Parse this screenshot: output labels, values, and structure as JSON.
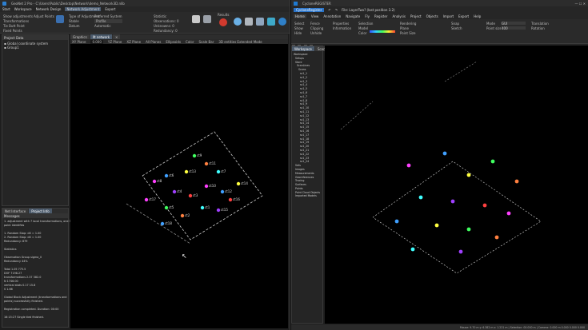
{
  "left_app": {
    "title": "GeoNet 2 Pro - C:\\Users\\Public\\Desktop\\Network\\demo_Network3D.nlib",
    "menu": [
      "Start",
      "Workspace",
      "Network Design",
      "Network Adjustment",
      "Export"
    ],
    "ribbon": {
      "g1": [
        "Show adjustments",
        "Transformations",
        "Tie Butt Point",
        "Fixed Points"
      ],
      "g2": [
        "Adjust Points"
      ],
      "g3": [
        "Type of Adjustment",
        "Stable",
        "Datum"
      ],
      "g4": [
        "Preferred System",
        "Profile",
        "Automatic"
      ],
      "g5": [
        "Statistic",
        "Observations: 0",
        "Unknowns: 0",
        "Redundancy: 0"
      ],
      "g6": [
        "Results"
      ]
    },
    "project_panel": {
      "title": "Project Data",
      "items": [
        "Global coordinate system",
        "Group1"
      ]
    },
    "messages": {
      "tabs": [
        "Net Interface",
        "Project Info"
      ],
      "title": "Messages",
      "lines": [
        "1. adjustment with 7 local transformations, one 3D",
        "point identifies",
        "",
        "1. Random Stop: dX = 1.00",
        "2. Random Stop: dX = 1.00",
        "Redundancy: 879",
        "",
        "Statistics",
        "",
        "Observation Group                 sigma_0",
        "Redundancy             44%",
        "",
        "Total                                   1.05       775.5",
        "DOF         7198.27",
        "transformations                2.37        382.0",
        "N             1746.00",
        "vertical stats                  0.17        15.8",
        "S             1.66",
        "",
        "Global Block Adjustment (transformations and",
        "points) successfully finished.",
        "",
        "Registration completed. Duration: 00:00",
        "",
        "16:15:27 Single tied finished."
      ]
    },
    "view": {
      "tabs": [
        "Graphics",
        "Ilt network",
        "×"
      ],
      "toolbar": [
        "XY Plane",
        "0.000",
        "YZ Plane",
        "XZ Plane",
        "All Planes",
        "Ellipsoids",
        "Color",
        "Scale Bar",
        "3D entities Extended Mode"
      ],
      "points": [
        "ct8",
        "ct6",
        "ct13",
        "ct9",
        "ct11",
        "ct7",
        "ct4",
        "ct3",
        "ct10",
        "ct12",
        "ct14",
        "ct5",
        "ct2",
        "ct1",
        "ct15",
        "ct16",
        "ct17",
        "ct18"
      ]
    }
  },
  "right_app": {
    "title": "CycloneREGISTER",
    "file_label": "File: LayerTwo? (last position 3.2)",
    "menu": [
      "Home",
      "View",
      "Annotation",
      "Navigate",
      "Fly",
      "Register",
      "Analysis",
      "Project",
      "Objects",
      "Import",
      "Export",
      "Help"
    ],
    "ribbon": {
      "g1": [
        "Select",
        "Show",
        "Hide"
      ],
      "g2": [
        "Fence",
        "Clipping",
        "Unhide"
      ],
      "g3": [
        "Properties",
        "Information"
      ],
      "g4": [
        "Selection",
        "Model",
        "Color"
      ],
      "g5": [
        "Rendering",
        "Plane",
        "Point Size"
      ],
      "g6": [
        "Snap",
        "Sketch"
      ],
      "g7": [
        "Mode",
        "Point size"
      ],
      "g8": [
        "Translation",
        "Rotation"
      ]
    },
    "combo_mode": "GUI",
    "combo_value": "400",
    "panel_tabs": [
      "Workspace",
      "Scene"
    ],
    "tree": [
      "Workspace",
      "Setups",
      "Store",
      "ScanLines",
      "Scans",
      "sc1_1",
      "sc1_2",
      "sc1_3",
      "sc1_4",
      "sc1_5",
      "sc1_6",
      "sc1_7",
      "sc1_8",
      "sc1_9",
      "sc1_10",
      "sc1_11",
      "sc1_12",
      "sc1_13",
      "sc1_14",
      "sc1_15",
      "sc1_16",
      "sc1_17",
      "sc1_18",
      "sc1_19",
      "sc1_20",
      "sc1_21",
      "sc1_22",
      "sc1_23",
      "sc1_24",
      "Sets",
      "Images",
      "Measurements",
      "Georeferences",
      "Tracing",
      "Surfaces",
      "Points",
      "Point Cloud Objects",
      "Imported Models"
    ],
    "status": "Mouse: 9.70 m  y: 6.382 m  z: 1.221 m  |  Selection: 00.000 m  |  Camera: 0.000 m  0.000  0.000  0.000"
  }
}
